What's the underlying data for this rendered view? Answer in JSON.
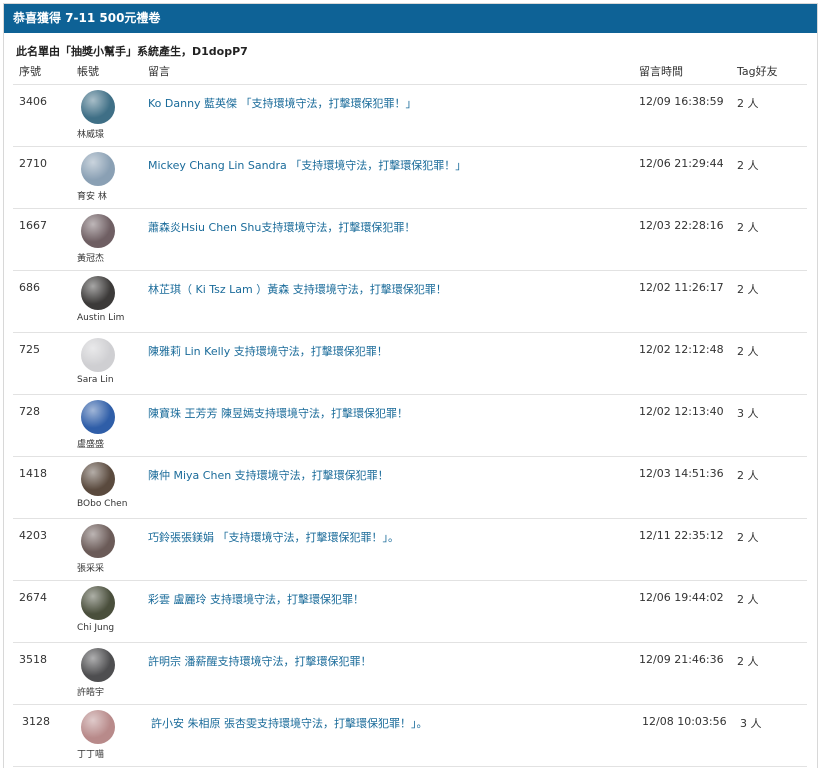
{
  "banner": {
    "title": "恭喜獲得 7-11 500元禮卷"
  },
  "subtitle": "此名單由「抽獎小幫手」系統產生，D1dopP7",
  "columns": {
    "id": "序號",
    "account": "帳號",
    "message": "留言",
    "time": "留言時間",
    "tag": "Tag好友"
  },
  "rows": [
    {
      "id": "3406",
      "name": "林威璟",
      "message": "Ko Danny 藍英傑 「支持環境守法，打擊環保犯罪！」",
      "time": "12/09 16:38:59",
      "tag": "2 人",
      "avatar_color": "#3f6f86"
    },
    {
      "id": "2710",
      "name": "育安 林",
      "message": "Mickey Chang Lin Sandra 「支持環境守法，打擊環保犯罪！」",
      "time": "12/06 21:29:44",
      "tag": "2 人",
      "avatar_color": "#8aa0b4"
    },
    {
      "id": "1667",
      "name": "黃冠杰",
      "message": "蕭森炎Hsiu Chen Shu支持環境守法，打擊環保犯罪！",
      "time": "12/03 22:28:16",
      "tag": "2 人",
      "avatar_color": "#6f5f63"
    },
    {
      "id": "686",
      "name": "Austin Lim",
      "message": "林芷琪（ Ki Tsz Lam ）黃森 支持環境守法，打擊環保犯罪！",
      "time": "12/02 11:26:17",
      "tag": "2 人",
      "avatar_color": "#3c3a39"
    },
    {
      "id": "725",
      "name": "Sara Lin",
      "message": "陳雅莉 Lin Kelly 支持環境守法，打擊環保犯罪！",
      "time": "12/02 12:12:48",
      "tag": "2 人",
      "avatar_color": "#cfcfd2"
    },
    {
      "id": "728",
      "name": "盧盛盛",
      "message": "陳寶珠 王芳芳 陳昱嫣支持環境守法，打擊環保犯罪！",
      "time": "12/02 12:13:40",
      "tag": "3 人",
      "avatar_color": "#2f5ea8"
    },
    {
      "id": "1418",
      "name": "BObo Chen",
      "message": "陳仲 Miya Chen 支持環境守法，打擊環保犯罪！",
      "time": "12/03 14:51:36",
      "tag": "2 人",
      "avatar_color": "#5a4a3e"
    },
    {
      "id": "4203",
      "name": "張采采",
      "message": "巧鈴張張鎂娟 「支持環境守法，打擊環保犯罪！」。",
      "time": "12/11 22:35:12",
      "tag": "2 人",
      "avatar_color": "#6b5b58"
    },
    {
      "id": "2674",
      "name": "Chi Jung",
      "message": "彩雲 盧麗玲 支持環境守法，打擊環保犯罪！",
      "time": "12/06 19:44:02",
      "tag": "2 人",
      "avatar_color": "#4a4f3c"
    },
    {
      "id": "3518",
      "name": "許皓宇",
      "message": "許明宗 潘薪醒支持環境守法，打擊環保犯罪！",
      "time": "12/09 21:46:36",
      "tag": "2 人",
      "avatar_color": "#4e4e50"
    },
    {
      "id": "3128",
      "name": "丁丁喵",
      "message": "許小安 朱相原 張杏雯支持環境守法，打擊環保犯罪！」。",
      "time": "12/08 10:03:56",
      "tag": "3 人",
      "avatar_color": "#b88a8a"
    }
  ]
}
